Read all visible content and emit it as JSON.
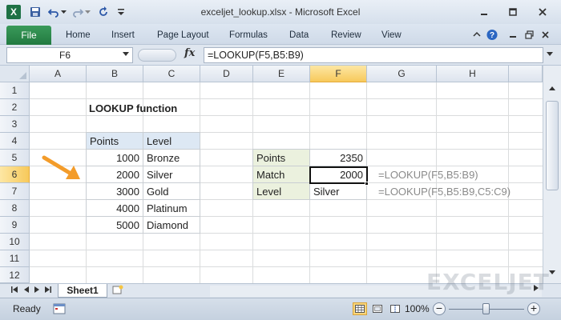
{
  "window": {
    "title": "exceljet_lookup.xlsx  -  Microsoft Excel",
    "app_icon_letter": "X"
  },
  "ribbon": {
    "tabs": [
      {
        "label": "File"
      },
      {
        "label": "Home"
      },
      {
        "label": "Insert"
      },
      {
        "label": "Page Layout"
      },
      {
        "label": "Formulas"
      },
      {
        "label": "Data"
      },
      {
        "label": "Review"
      },
      {
        "label": "View"
      }
    ]
  },
  "formula_bar": {
    "name_box": "F6",
    "fx_label": "fx",
    "formula": "=LOOKUP(F5,B5:B9)"
  },
  "columns": [
    "A",
    "B",
    "C",
    "D",
    "E",
    "F",
    "G",
    "H"
  ],
  "active_column": "F",
  "rows": [
    "1",
    "2",
    "3",
    "4",
    "5",
    "6",
    "7",
    "8",
    "9",
    "10",
    "11",
    "12"
  ],
  "active_row": "6",
  "sheet": {
    "title": "LOOKUP function",
    "lookup_table": {
      "headers": [
        "Points",
        "Level"
      ],
      "rows": [
        {
          "points": "1000",
          "level": "Bronze"
        },
        {
          "points": "2000",
          "level": "Silver"
        },
        {
          "points": "3000",
          "level": "Gold"
        },
        {
          "points": "4000",
          "level": "Platinum"
        },
        {
          "points": "5000",
          "level": "Diamond"
        }
      ]
    },
    "result_table": {
      "rows": [
        {
          "label": "Points",
          "value": "2350"
        },
        {
          "label": "Match",
          "value": "2000"
        },
        {
          "label": "Level",
          "value": "Silver"
        }
      ]
    },
    "formula_notes": [
      "=LOOKUP(F5,B5:B9)",
      "=LOOKUP(F5,B5:B9,C5:C9)"
    ]
  },
  "sheet_tabs": {
    "tabs": [
      "Sheet1"
    ]
  },
  "watermark": "EXCELJET",
  "status_bar": {
    "status": "Ready",
    "zoom": "100%"
  },
  "colors": {
    "accent": "#217346",
    "arrow": "#f39c2a",
    "header_fill": "#dde8f4",
    "label_fill": "#ebf1de",
    "note_text": "#8a8a8a"
  }
}
